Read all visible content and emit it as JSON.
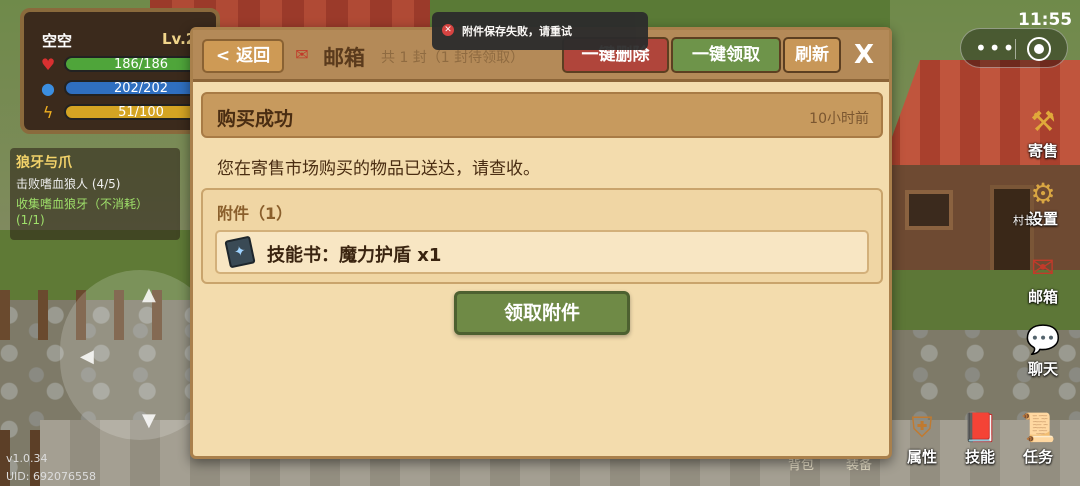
{
  "status_bar": {
    "time": "11:55"
  },
  "player": {
    "name": "空空",
    "level": "Lv.2",
    "hp": "186/186",
    "mp": "202/202",
    "stamina": "51/100",
    "hp_icon": "heart-icon",
    "mp_icon": "drop-icon",
    "sp_icon": "lightning-icon"
  },
  "quest": {
    "title": "狼牙与爪",
    "objectives": [
      {
        "text": "击败嗜血狼人 (4/5)"
      },
      {
        "text": "收集嗜血狼牙（不消耗）"
      },
      {
        "text": "(1/1)"
      }
    ]
  },
  "footer": {
    "version": "v1.0.34",
    "uid": "UID: 692076558"
  },
  "side_menu": {
    "consign": "寄售",
    "settings": "设置",
    "npc": "村长",
    "mail": "邮箱",
    "chat": "聊天"
  },
  "bottom_menu": {
    "bag": "背包",
    "equip": "装备",
    "attributes": "属性",
    "skills": "技能",
    "tasks": "任务"
  },
  "mail": {
    "back_label": "< 返回",
    "title": "邮箱",
    "count_text": "共 1 封（1 封待领取）",
    "delete_all_label": "一键删除",
    "claim_all_label": "一键领取",
    "refresh_label": "刷新",
    "close_label": "X",
    "subject": "购买成功",
    "time": "10小时前",
    "body": "您在寄售市场购买的物品已送达，请查收。",
    "attachments_title": "附件（1）",
    "attachment_name": "技能书：魔力护盾 x1",
    "claim_label": "领取附件"
  },
  "toast": {
    "message": "附件保存失败，请重试"
  },
  "colors": {
    "panel_bg": "#f3dcad",
    "header_bg": "#b48a58",
    "delete_red": "#b0453b",
    "claim_green": "#6e944a",
    "hp_green": "#4fa53a",
    "mp_blue": "#2f6fc0",
    "sp_yellow": "#d4a423"
  }
}
